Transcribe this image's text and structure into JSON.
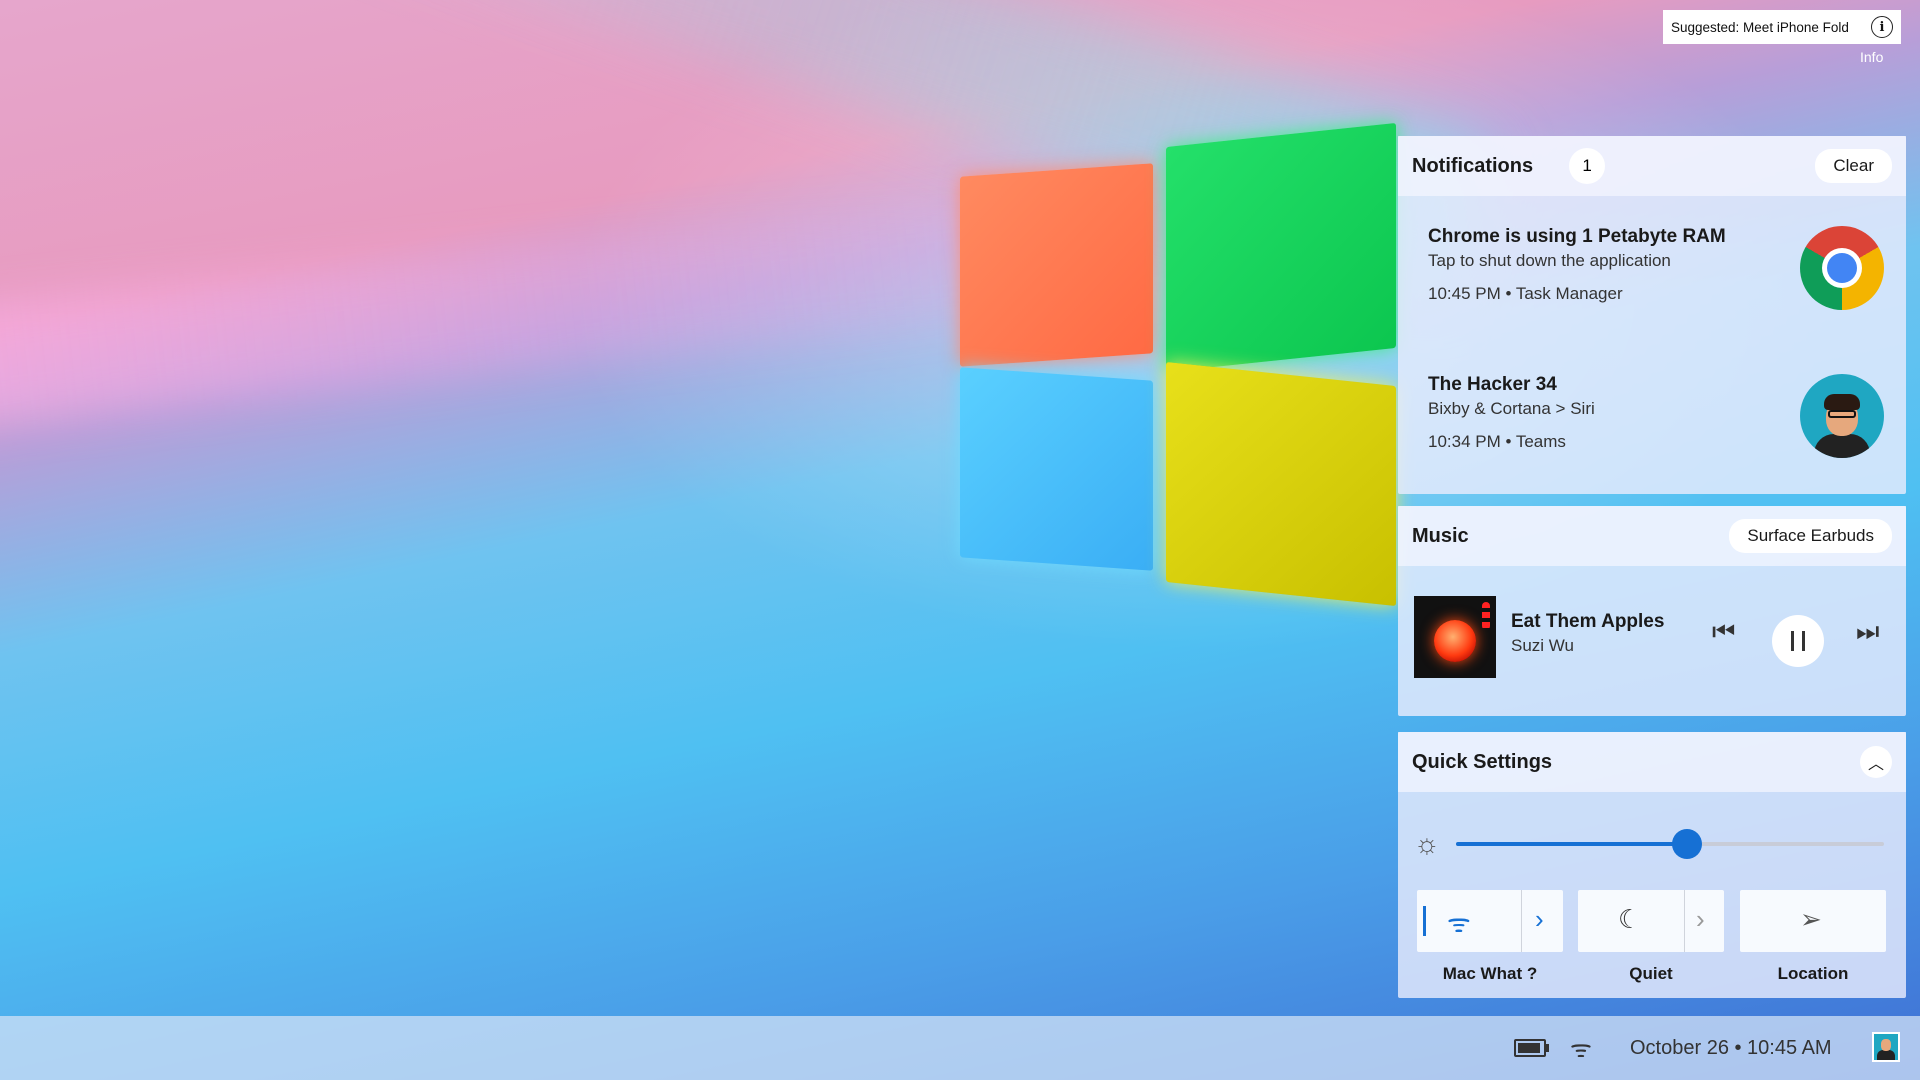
{
  "suggestion": {
    "text": "Suggested: Meet iPhone Fold",
    "info_label": "Info",
    "info_icon": "info-circle-icon"
  },
  "notifications": {
    "title": "Notifications",
    "count": "1",
    "clear_label": "Clear",
    "items": [
      {
        "title": "Chrome is using 1 Petabyte RAM",
        "subtitle": "Tap to shut down the application",
        "meta": "10:45 PM • Task Manager",
        "icon": "chrome-icon"
      },
      {
        "title": "The Hacker 34",
        "subtitle": "Bixby & Cortana > Siri",
        "meta": "10:34 PM • Teams",
        "icon": "avatar-icon"
      }
    ]
  },
  "music": {
    "title": "Music",
    "device": "Surface Earbuds",
    "song": "Eat Them Apples",
    "artist": "Suzi Wu",
    "state": "playing"
  },
  "quick_settings": {
    "title": "Quick Settings",
    "brightness": 0.54,
    "accent_color": "#1670d4",
    "tiles": [
      {
        "label": "Mac What ?",
        "icon": "wifi-icon",
        "active": true
      },
      {
        "label": "Quiet",
        "icon": "moon-icon",
        "active": false
      },
      {
        "label": "Location",
        "icon": "location-arrow-icon",
        "active": false
      }
    ]
  },
  "taskbar": {
    "clock": "October 26 • 10:45 AM",
    "icons": [
      "battery-icon",
      "wifi-icon",
      "user-avatar-icon"
    ]
  }
}
